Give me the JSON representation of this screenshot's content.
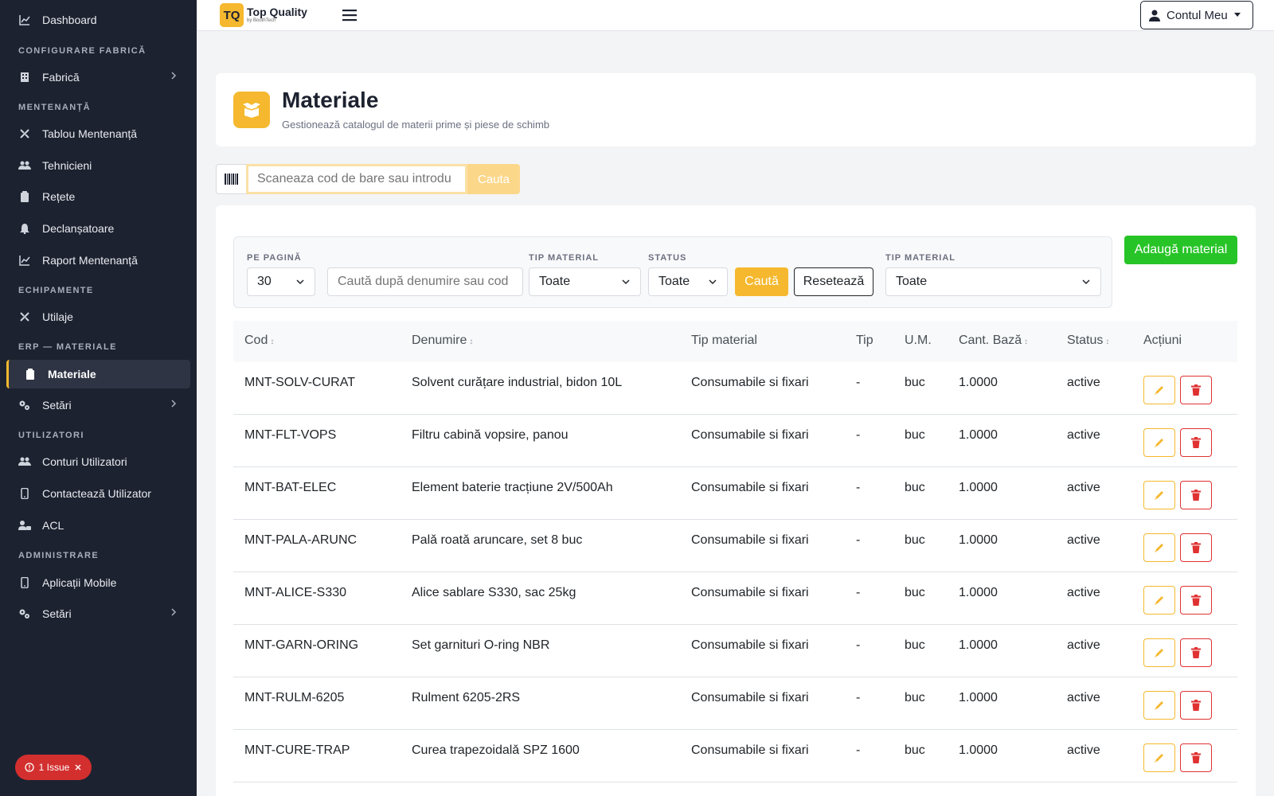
{
  "sidebar": {
    "dashboard": "Dashboard",
    "sections": {
      "configurare": "CONFIGURARE FABRICĂ",
      "mentenanta": "MENTENANȚĂ",
      "echipamente": "ECHIPAMENTE",
      "erp": "ERP — MATERIALE",
      "utilizatori": "UTILIZATORI",
      "administrare": "ADMINISTRARE"
    },
    "items": {
      "fabrica": "Fabrică",
      "tablou": "Tablou Mentenanță",
      "tehnicieni": "Tehnicieni",
      "retete": "Rețete",
      "declansatoare": "Declanșatoare",
      "raport": "Raport Mentenanță",
      "utilaje": "Utilaje",
      "materiale": "Materiale",
      "setari_erp": "Setări",
      "conturi": "Conturi Utilizatori",
      "contacteaza": "Contactează Utilizator",
      "acl": "ACL",
      "aplicatii": "Aplicații Mobile",
      "setari_admin": "Setări"
    },
    "issue_badge": "1 Issue"
  },
  "topbar": {
    "logo_mark": "TQ",
    "logo_title": "Top Quality",
    "logo_sub": "by BoothTech",
    "account": "Contul Meu"
  },
  "header": {
    "title": "Materiale",
    "subtitle": "Gestionează catalogul de materii prime și piese de schimb"
  },
  "barcode": {
    "placeholder": "Scaneaza cod de bare sau introdu",
    "button": "Cauta"
  },
  "filters": {
    "per_page_label": "PE PAGINĂ",
    "per_page_value": "30",
    "search_placeholder": "Caută după denumire sau cod",
    "tip_material_label": "TIP MATERIAL",
    "tip_material_value": "Toate",
    "status_label": "STATUS",
    "status_value": "Toate",
    "search_button": "Caută",
    "reset_button": "Resetează",
    "tip_material2_label": "TIP MATERIAL",
    "tip_material2_value": "Toate",
    "add_button": "Adaugă material"
  },
  "table": {
    "columns": [
      "Cod",
      "Denumire",
      "Tip material",
      "Tip",
      "U.M.",
      "Cant. Bază",
      "Status",
      "Acțiuni"
    ],
    "sort_glyph": "↕",
    "rows": [
      {
        "cod": "MNT-SOLV-CURAT",
        "denumire": "Solvent curățare industrial, bidon 10L",
        "tip_material": "Consumabile si fixari",
        "tip": "-",
        "um": "buc",
        "cant": "1.0000",
        "status": "active"
      },
      {
        "cod": "MNT-FLT-VOPS",
        "denumire": "Filtru cabină vopsire, panou",
        "tip_material": "Consumabile si fixari",
        "tip": "-",
        "um": "buc",
        "cant": "1.0000",
        "status": "active"
      },
      {
        "cod": "MNT-BAT-ELEC",
        "denumire": "Element baterie tracțiune 2V/500Ah",
        "tip_material": "Consumabile si fixari",
        "tip": "-",
        "um": "buc",
        "cant": "1.0000",
        "status": "active"
      },
      {
        "cod": "MNT-PALA-ARUNC",
        "denumire": "Palǎ roatǎ aruncare, set 8 buc",
        "tip_material": "Consumabile si fixari",
        "tip": "-",
        "um": "buc",
        "cant": "1.0000",
        "status": "active"
      },
      {
        "cod": "MNT-ALICE-S330",
        "denumire": "Alice sablare S330, sac 25kg",
        "tip_material": "Consumabile si fixari",
        "tip": "-",
        "um": "buc",
        "cant": "1.0000",
        "status": "active"
      },
      {
        "cod": "MNT-GARN-ORING",
        "denumire": "Set garnituri O-ring NBR",
        "tip_material": "Consumabile si fixari",
        "tip": "-",
        "um": "buc",
        "cant": "1.0000",
        "status": "active"
      },
      {
        "cod": "MNT-RULM-6205",
        "denumire": "Rulment 6205-2RS",
        "tip_material": "Consumabile si fixari",
        "tip": "-",
        "um": "buc",
        "cant": "1.0000",
        "status": "active"
      },
      {
        "cod": "MNT-CURE-TRAP",
        "denumire": "Curea trapezoidalǎ SPZ 1600",
        "tip_material": "Consumabile si fixari",
        "tip": "-",
        "um": "buc",
        "cant": "1.0000",
        "status": "active"
      }
    ]
  },
  "colors": {
    "accent": "#f5b82e",
    "sidebar_bg": "#1d2230",
    "success": "#27c427",
    "danger": "#e03131"
  }
}
